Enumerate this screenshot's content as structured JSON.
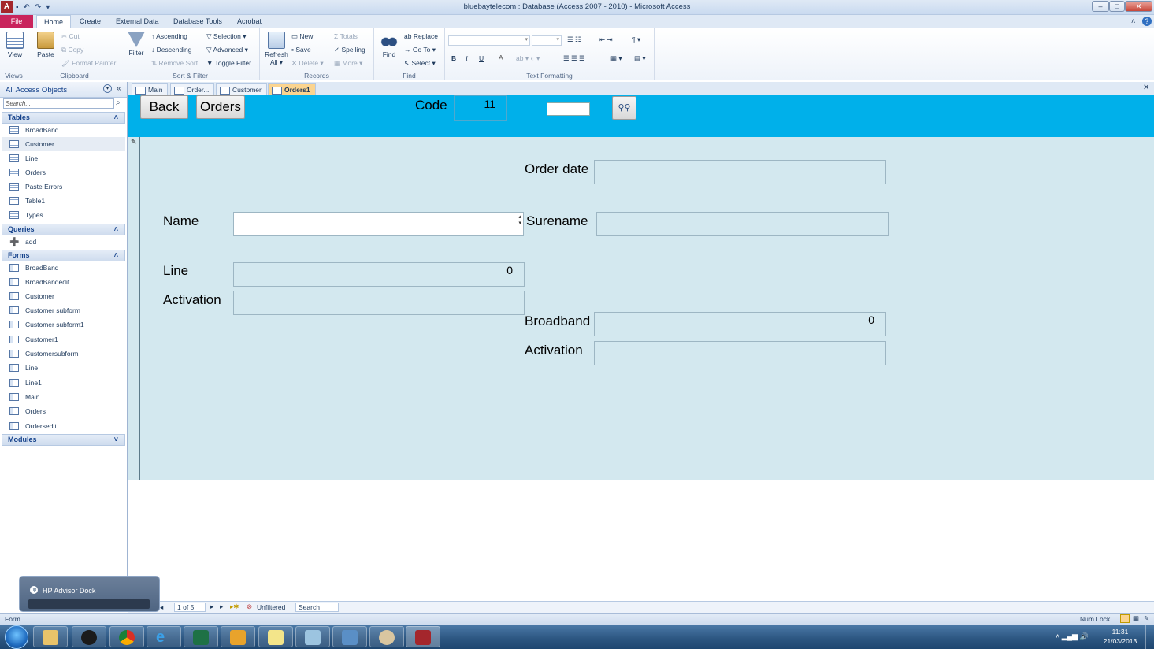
{
  "window": {
    "title": "bluebaytelecom : Database (Access 2007 - 2010)  -  Microsoft Access",
    "app_icon_letter": "A"
  },
  "ribbon_tabs": [
    "File",
    "Home",
    "Create",
    "External Data",
    "Database Tools",
    "Acrobat"
  ],
  "ribbon": {
    "views": {
      "view_label": "View",
      "group": "Views"
    },
    "clipboard": {
      "paste": "Paste",
      "cut": "Cut",
      "copy": "Copy",
      "format_painter": "Format Painter",
      "group": "Clipboard"
    },
    "sort_filter": {
      "filter": "Filter",
      "ascending": "Ascending",
      "descending": "Descending",
      "remove_sort": "Remove Sort",
      "selection": "Selection",
      "advanced": "Advanced",
      "toggle_filter": "Toggle Filter",
      "group": "Sort & Filter"
    },
    "records": {
      "refresh": "Refresh",
      "refresh_all": "All",
      "new": "New",
      "save": "Save",
      "delete": "Delete",
      "totals": "Totals",
      "spelling": "Spelling",
      "more": "More",
      "group": "Records"
    },
    "find": {
      "find": "Find",
      "replace": "Replace",
      "goto": "Go To",
      "select": "Select",
      "group": "Find"
    },
    "text_formatting": {
      "group": "Text Formatting",
      "bold": "B",
      "italic": "I",
      "underline": "U",
      "font_color": "A"
    }
  },
  "nav_pane": {
    "title": "All Access Objects",
    "search_placeholder": "Search...",
    "sections": {
      "tables": {
        "title": "Tables",
        "items": [
          "BroadBand",
          "Customer",
          "Line",
          "Orders",
          "Paste Errors",
          "Table1",
          "Types"
        ]
      },
      "queries": {
        "title": "Queries",
        "items": [
          "add"
        ]
      },
      "forms": {
        "title": "Forms",
        "items": [
          "BroadBand",
          "BroadBandedit",
          "Customer",
          "Customer subform",
          "Customer subform1",
          "Customer1",
          "Customersubform",
          "Line",
          "Line1",
          "Main",
          "Orders",
          "Ordersedit"
        ]
      },
      "modules": {
        "title": "Modules"
      }
    }
  },
  "doc_tabs": [
    "Main",
    "Order...",
    "Customer",
    "Orders1"
  ],
  "form": {
    "back_button": "Back",
    "orders_button": "Orders",
    "code_label": "Code",
    "code_value": "11",
    "order_date_label": "Order date",
    "name_label": "Name",
    "surename_label": "Surename",
    "line_label": "Line",
    "line_value": "0",
    "activation_label": "Activation",
    "broadband_label": "Broadband",
    "broadband_value": "0",
    "activation2_label": "Activation"
  },
  "record_nav": {
    "position": "1 of 5",
    "filter": "Unfiltered",
    "search": "Search"
  },
  "status_bar": {
    "left": "Form",
    "num_lock": "Num Lock"
  },
  "hp_dock": {
    "title": "HP Advisor Dock"
  },
  "clock": {
    "time": "11:31",
    "date": "21/03/2013"
  },
  "colors": {
    "form_header": "#00b0ea",
    "form_detail": "#d3e8ef",
    "file_tab": "#c9245c",
    "active_doc_tab": "#fbd48f"
  }
}
